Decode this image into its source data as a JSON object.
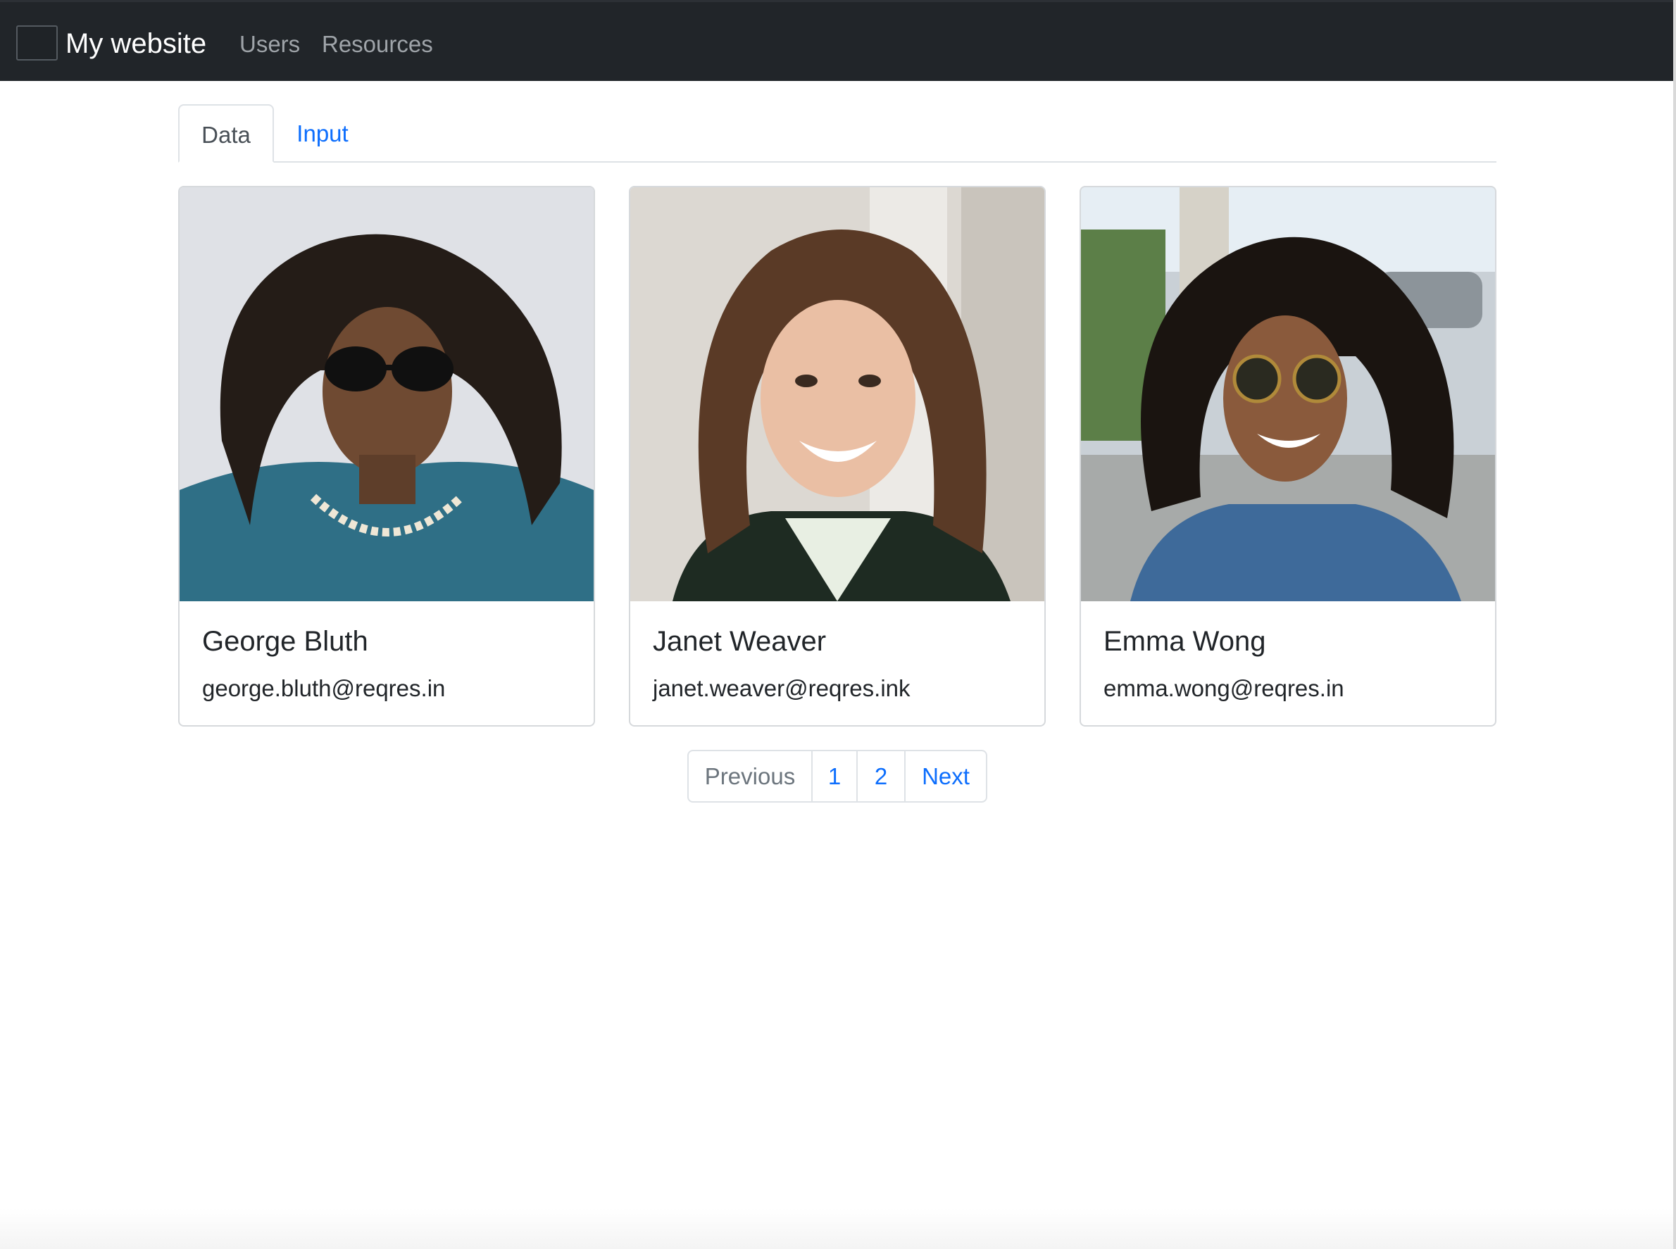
{
  "navbar": {
    "logo_icon": "logo-placeholder",
    "brand": "My website",
    "links": [
      {
        "label": "Users"
      },
      {
        "label": "Resources"
      }
    ]
  },
  "tabs": [
    {
      "label": "Data",
      "active": true
    },
    {
      "label": "Input",
      "active": false
    }
  ],
  "users": [
    {
      "name": "George Bluth",
      "email": "george.bluth@reqres.in"
    },
    {
      "name": "Janet Weaver",
      "email": "janet.weaver@reqres.ink"
    },
    {
      "name": "Emma Wong",
      "email": "emma.wong@reqres.in"
    }
  ],
  "pagination": {
    "previous": "Previous",
    "pages": [
      "1",
      "2"
    ],
    "next": "Next"
  },
  "colors": {
    "navbar_bg": "#212529",
    "link_blue": "#0d6efd",
    "muted": "#6c757d"
  }
}
